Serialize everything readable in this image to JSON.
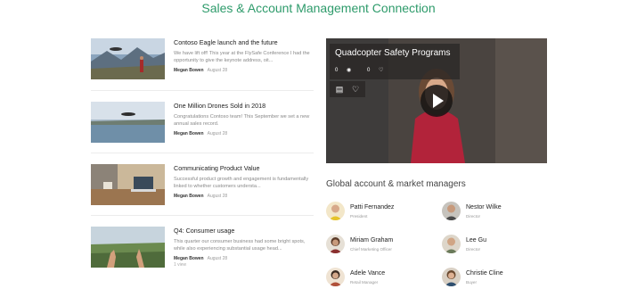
{
  "site": {
    "title": "Sales & Account Management Connection"
  },
  "news": [
    {
      "title": "Contoso Eagle launch and the future",
      "snippet": "We have lift off! This year at the FlySafe Conference I had the opportunity to give the keynote address, oit...",
      "author": "Megan Bowen",
      "date": "August 28",
      "extra": ""
    },
    {
      "title": "One Million Drones Sold in 2018",
      "snippet": "Congratulations Contoso team! This September we set a new annual sales record.",
      "author": "Megan Bowen",
      "date": "August 28",
      "extra": ""
    },
    {
      "title": "Communicating Product Value",
      "snippet": "Successful product growth and engagement is fundamentally linked to whether customers understa...",
      "author": "Megan Bowen",
      "date": "August 28",
      "extra": ""
    },
    {
      "title": "Q4: Consumer usage",
      "snippet": "This quarter our consumer business had some bright spots, while also experiencing substantial usage head...",
      "author": "Megan Bowen",
      "date": "August 28",
      "extra": "1 view"
    }
  ],
  "video": {
    "title": "Quadcopter Safety Programs",
    "views": "0",
    "likes": "0"
  },
  "people_section": {
    "title": "Global account & market managers",
    "people": [
      {
        "name": "Patti Fernandez",
        "role": "President"
      },
      {
        "name": "Nestor Wilke",
        "role": "Director"
      },
      {
        "name": "Miriam Graham",
        "role": "Chief Marketing Officer"
      },
      {
        "name": "Lee Gu",
        "role": "Director"
      },
      {
        "name": "Adele Vance",
        "role": "Retail Manager"
      },
      {
        "name": "Christie Cline",
        "role": "Buyer"
      }
    ]
  },
  "colors": {
    "brand": "#2e9b6b"
  },
  "icons": {
    "video_views": "eye-icon",
    "video_likes": "heart-icon",
    "save": "bookmark-icon",
    "like": "heart-icon"
  }
}
